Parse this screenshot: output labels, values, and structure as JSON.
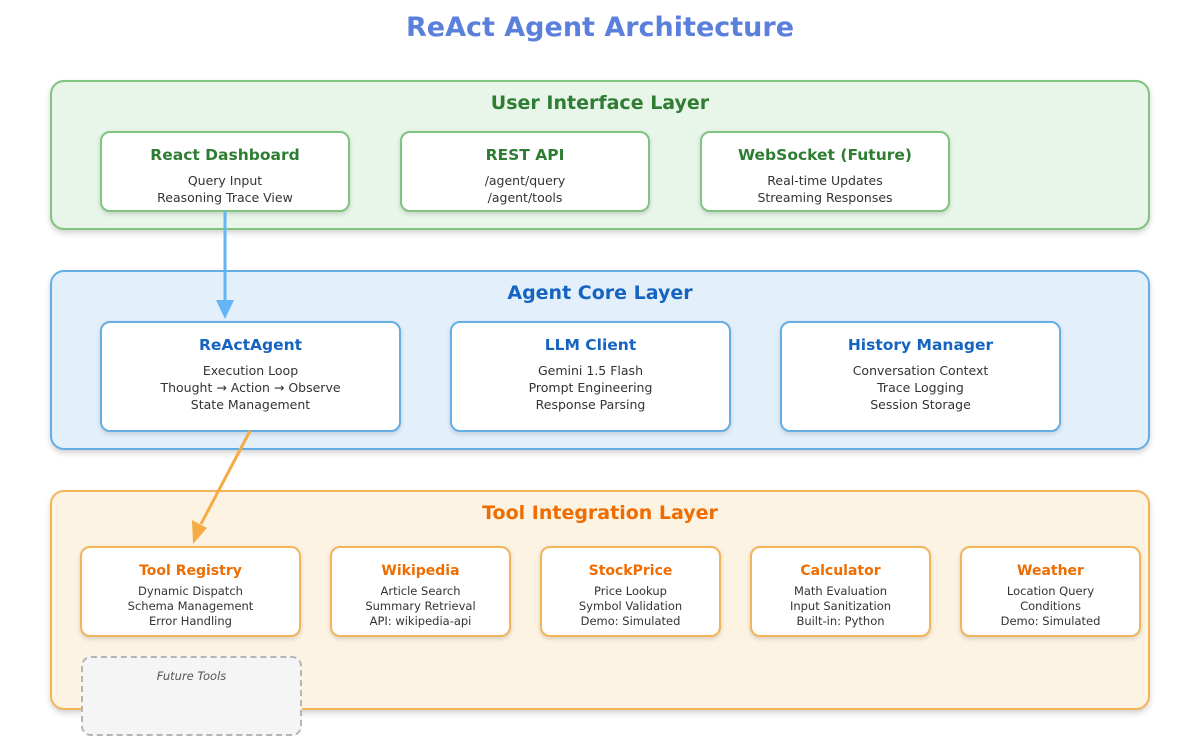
{
  "title": "ReAct Agent Architecture",
  "layers": {
    "ui": {
      "title": "User Interface Layer",
      "cards": [
        {
          "title": "React Dashboard",
          "lines": [
            "Query Input",
            "Reasoning Trace View"
          ]
        },
        {
          "title": "REST API",
          "lines": [
            "/agent/query",
            "/agent/tools"
          ]
        },
        {
          "title": "WebSocket (Future)",
          "lines": [
            "Real-time Updates",
            "Streaming Responses"
          ]
        }
      ]
    },
    "core": {
      "title": "Agent Core Layer",
      "cards": [
        {
          "title": "ReActAgent",
          "lines": [
            "Execution Loop",
            "Thought → Action → Observe",
            "State Management"
          ]
        },
        {
          "title": "LLM Client",
          "lines": [
            "Gemini 1.5 Flash",
            "Prompt Engineering",
            "Response Parsing"
          ]
        },
        {
          "title": "History Manager",
          "lines": [
            "Conversation Context",
            "Trace Logging",
            "Session Storage"
          ]
        }
      ]
    },
    "tool": {
      "title": "Tool Integration Layer",
      "cards": [
        {
          "title": "Tool Registry",
          "lines": [
            "Dynamic Dispatch",
            "Schema Management",
            "Error Handling"
          ]
        },
        {
          "title": "Wikipedia",
          "lines": [
            "Article Search",
            "Summary Retrieval",
            "API: wikipedia-api"
          ]
        },
        {
          "title": "StockPrice",
          "lines": [
            "Price Lookup",
            "Symbol Validation",
            "Demo: Simulated"
          ]
        },
        {
          "title": "Calculator",
          "lines": [
            "Math Evaluation",
            "Input Sanitization",
            "Built-in: Python"
          ]
        },
        {
          "title": "Weather",
          "lines": [
            "Location Query",
            "Conditions",
            "Demo: Simulated"
          ]
        }
      ],
      "future": "Future Tools"
    }
  },
  "colors": {
    "title": "#5b7fdc",
    "ui_accent": "#2e7d32",
    "core_accent": "#1565c0",
    "tool_accent": "#ef6c00",
    "arrow_blue": "#64b5f6",
    "arrow_orange": "#f5ac45"
  }
}
